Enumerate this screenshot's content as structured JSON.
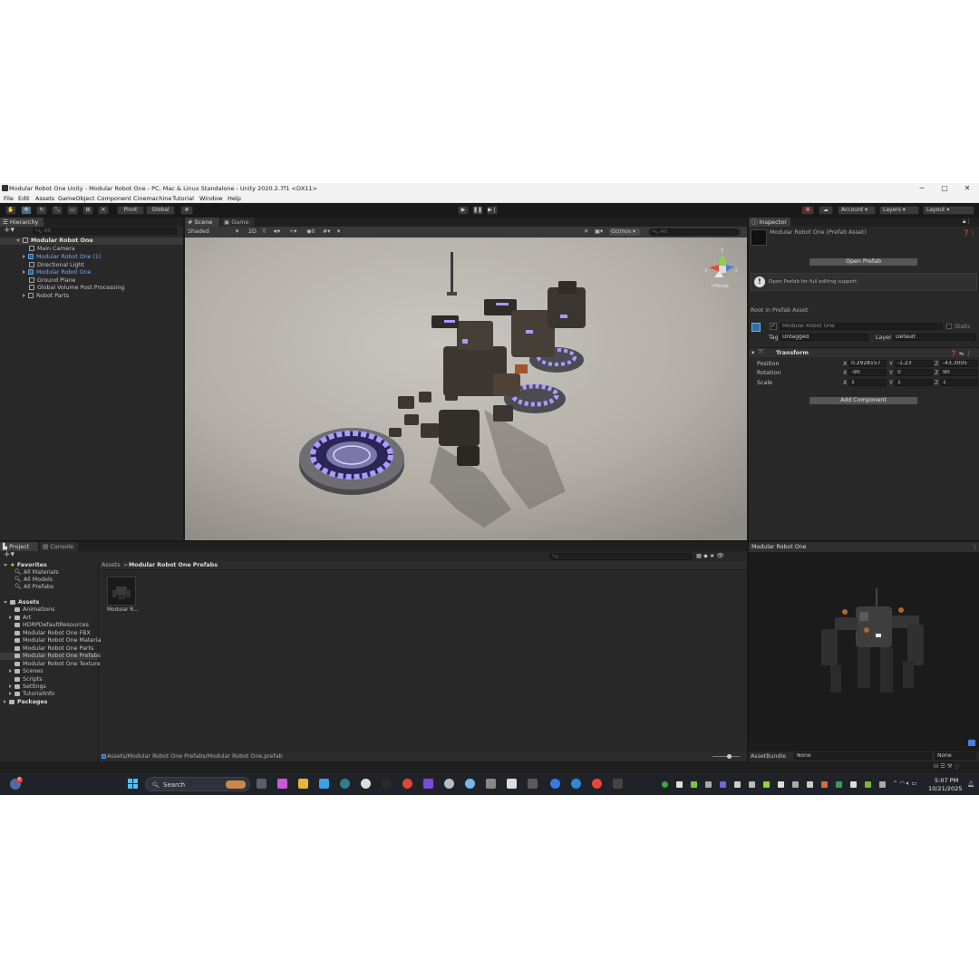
{
  "window": {
    "title": "Modular Robot One Unity - Modular Robot One - PC, Mac & Linux Standalone - Unity 2020.2.7f1 <DX11>",
    "minimize": "─",
    "maximize": "▢",
    "close": "✕"
  },
  "menu": [
    "File",
    "Edit",
    "Assets",
    "GameObject",
    "Component",
    "Cinemachine",
    "Tutorial",
    "Window",
    "Help"
  ],
  "toolbar": {
    "pivot": "Pivot",
    "global": "Global",
    "account": "Account",
    "layers": "Layers",
    "layout": "Layout"
  },
  "hierarchy": {
    "tab": "Hierarchy",
    "search_placeholder": "All",
    "root": "Modular Robot One",
    "items": [
      {
        "label": "Main Camera"
      },
      {
        "label": "Modular Robot One (1)"
      },
      {
        "label": "Directional Light"
      },
      {
        "label": "Modular Robot One"
      },
      {
        "label": "Ground Plane"
      },
      {
        "label": "Global Volume Post Processing"
      },
      {
        "label": "Robot Parts"
      }
    ]
  },
  "scene": {
    "tab_scene": "Scene",
    "tab_game": "Game",
    "shading": "Shaded",
    "mode_2d": "2D",
    "gizmos": "Gizmos",
    "search_placeholder": "All",
    "persp": "≺Persp",
    "gizmo_y": "y",
    "gizmo_x": "x",
    "gizmo_z": "z"
  },
  "inspector": {
    "tab": "Inspector",
    "asset_title": "Modular Robot One (Prefab Asset)",
    "open_prefab": "Open Prefab",
    "help_text": "Open Prefab for full editing support.",
    "root_label": "Root in Prefab Asset",
    "object_name": "Modular Robot One",
    "static_label": "Static",
    "tag_label": "Tag",
    "tag_value": "Untagged",
    "layer_label": "Layer",
    "layer_value": "Default",
    "component": "Transform",
    "rows": [
      {
        "label": "Position",
        "x": "0.2928157",
        "y": "-1.23",
        "z": "-43.3005"
      },
      {
        "label": "Rotation",
        "x": "-90",
        "y": "0",
        "z": "90"
      },
      {
        "label": "Scale",
        "x": "1",
        "y": "1",
        "z": "1"
      }
    ],
    "axis_x": "X",
    "axis_y": "Y",
    "axis_z": "Z",
    "add_component": "Add Component"
  },
  "project": {
    "tab_project": "Project",
    "tab_console": "Console",
    "favorites": "Favorites",
    "fav_items": [
      "All Materials",
      "All Models",
      "All Prefabs"
    ],
    "assets": "Assets",
    "asset_folders": [
      "Animations",
      "Art",
      "HDRPDefaultResources",
      "Modular Robot One FBX",
      "Modular Robot One Materia",
      "Modular Robot One Parts",
      "Modular Robot One Prefabs",
      "Modular Robot One Texture",
      "Scenes",
      "Scripts",
      "Settings",
      "TutorialInfo"
    ],
    "packages": "Packages",
    "breadcrumb_root": "Assets",
    "breadcrumb_sep": ">",
    "breadcrumb_current": "Modular Robot One Prefabs",
    "asset_item": "Modular R...",
    "status_path": "Assets/Modular Robot One Prefabs/Modular Robot One.prefab"
  },
  "preview": {
    "title": "Modular Robot One",
    "assetbundle_label": "AssetBundle",
    "assetbundle_value": "None",
    "variant_value": "None"
  },
  "taskbar": {
    "search": "Search",
    "time": "5:07 PM",
    "date": "10/21/2025",
    "badge": "6"
  },
  "colors": {
    "editor_bg": "#282828",
    "accent_blue": "#7aa7f0",
    "glow": "#7b6cff"
  }
}
